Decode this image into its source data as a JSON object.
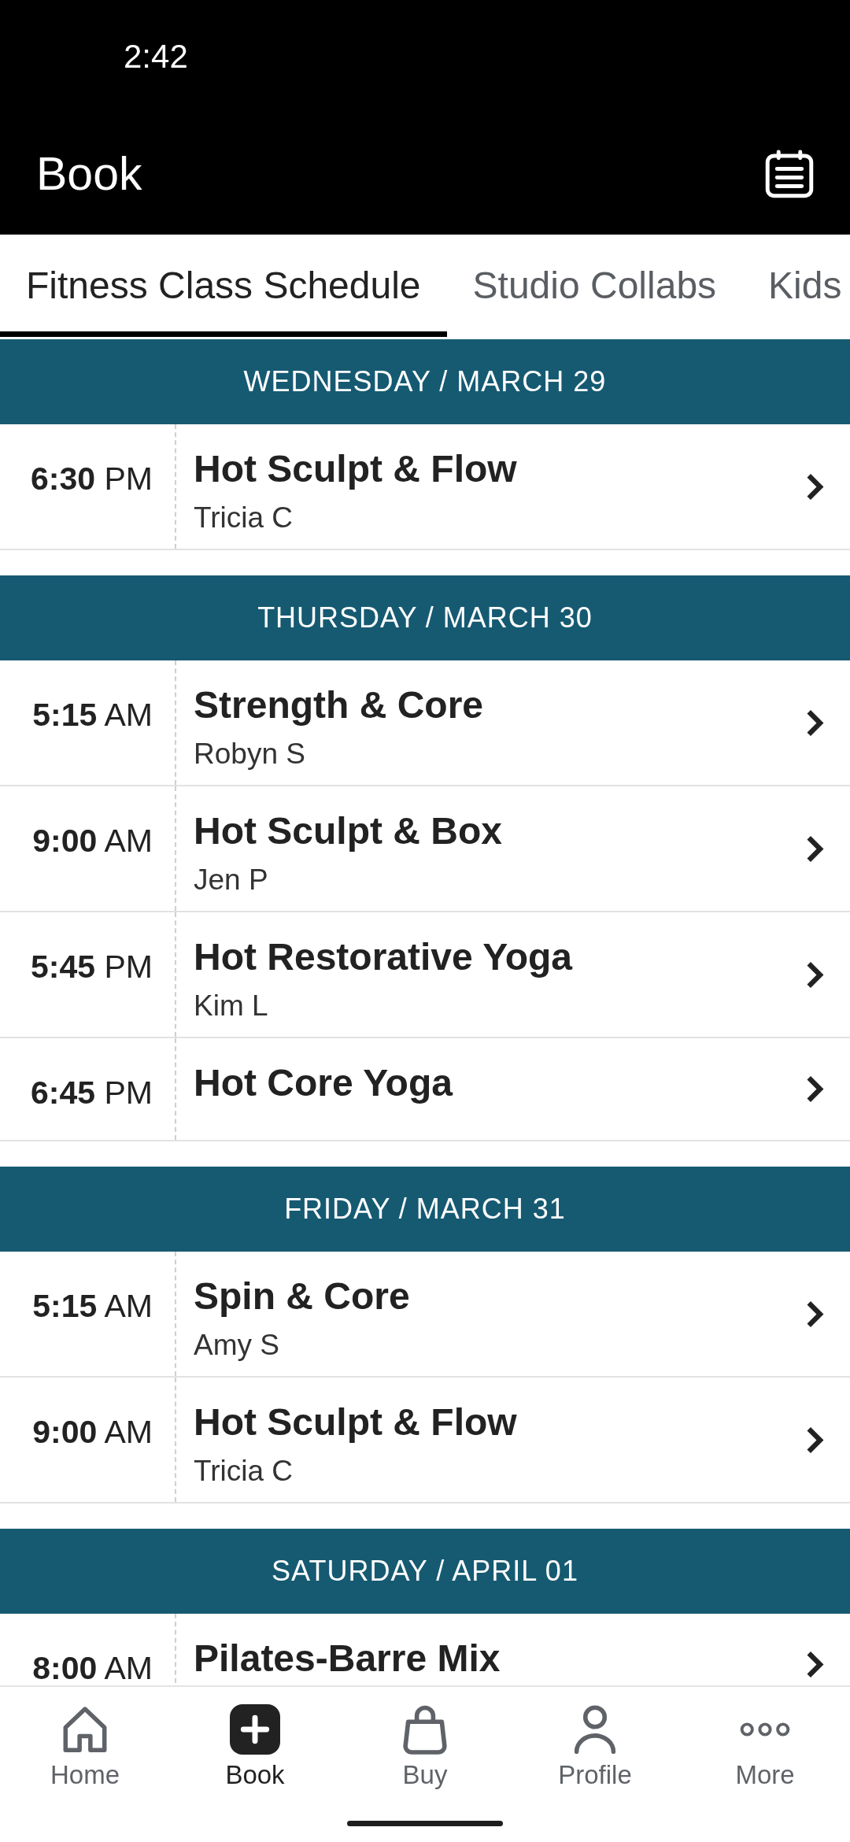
{
  "status_bar": {
    "time": "2:42"
  },
  "header": {
    "title": "Book"
  },
  "tabs": [
    {
      "label": "Fitness Class Schedule",
      "selected": true
    },
    {
      "label": "Studio Collabs",
      "selected": false
    },
    {
      "label": "Kids",
      "selected": false
    }
  ],
  "schedule": [
    {
      "date": "WEDNESDAY / MARCH 29",
      "classes": [
        {
          "time": "**6:30** PM",
          "name": "Hot Sculpt & Flow",
          "instructor": "Tricia C"
        }
      ]
    },
    {
      "date": "THURSDAY / MARCH 30",
      "classes": [
        {
          "time": "**5:15** AM",
          "name": "Strength & Core",
          "instructor": "Robyn S"
        },
        {
          "time": "**9:00** AM",
          "name": "Hot Sculpt & Box",
          "instructor": "Jen P"
        },
        {
          "time": "**5:45** PM",
          "name": "Hot Restorative Yoga",
          "instructor": "Kim L"
        },
        {
          "time": "**6:45** PM",
          "name": "Hot Core Yoga"
        }
      ]
    },
    {
      "date": "FRIDAY / MARCH 31",
      "classes": [
        {
          "time": "**5:15** AM",
          "name": "Spin & Core",
          "instructor": "Amy S"
        },
        {
          "time": "**9:00** AM",
          "name": "Hot Sculpt & Flow",
          "instructor": "Tricia C"
        }
      ]
    },
    {
      "date": "SATURDAY / APRIL 01",
      "classes": [
        {
          "time": "**8:00** AM",
          "name": "Pilates-Barre Mix"
        }
      ]
    }
  ],
  "bottom_nav": {
    "items": [
      {
        "label": "Home",
        "selected": false
      },
      {
        "label": "Book",
        "selected": true
      },
      {
        "label": "Buy",
        "selected": false
      },
      {
        "label": "Profile",
        "selected": false
      },
      {
        "label": "More",
        "selected": false
      }
    ]
  }
}
